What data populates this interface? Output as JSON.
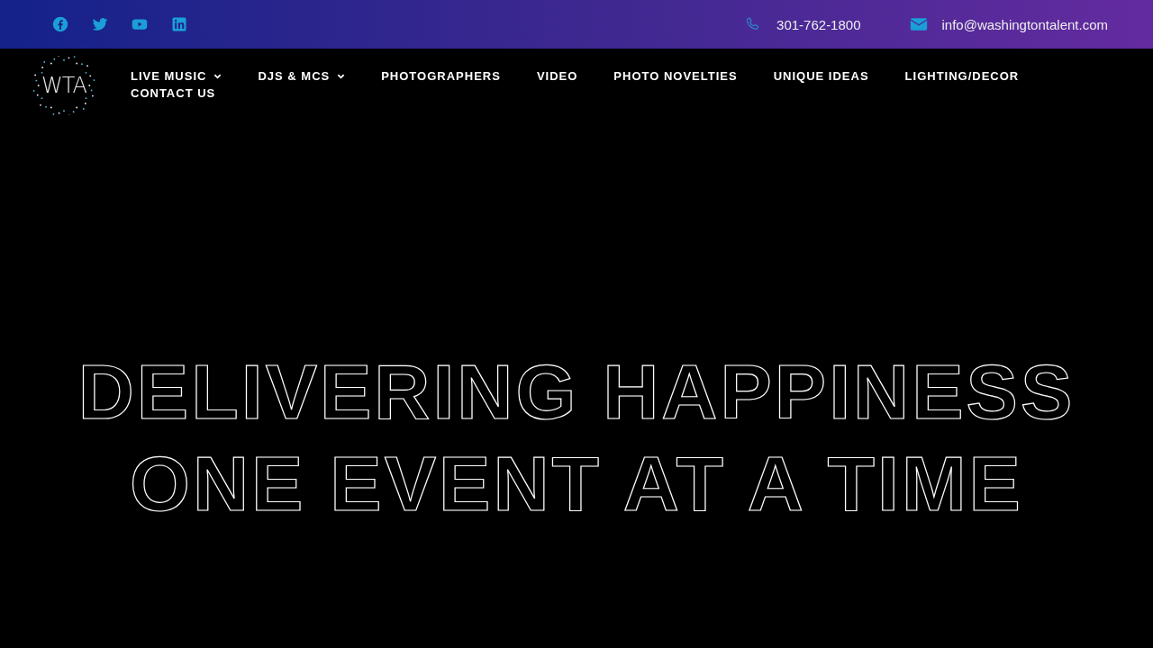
{
  "top_bar": {
    "social_links": [
      {
        "kind": "facebook"
      },
      {
        "kind": "twitter"
      },
      {
        "kind": "youtube"
      },
      {
        "kind": "linkedin"
      }
    ],
    "contacts": [
      {
        "kind": "phone",
        "text": "301-762-1800"
      },
      {
        "kind": "email",
        "text": "info@washingtontalent.com"
      }
    ]
  },
  "header": {
    "logo_text": "WTA",
    "nav": [
      {
        "label": "LIVE MUSIC",
        "has_menu": true
      },
      {
        "label": "DJS & MCS",
        "has_menu": true
      },
      {
        "label": "PHOTOGRAPHERS",
        "has_menu": false
      },
      {
        "label": "VIDEO",
        "has_menu": false
      },
      {
        "label": "PHOTO NOVELTIES",
        "has_menu": false
      },
      {
        "label": "UNIQUE IDEAS",
        "has_menu": false
      },
      {
        "label": "LIGHTING/DECOR",
        "has_menu": false
      },
      {
        "label": "CONTACT US",
        "has_menu": false
      }
    ]
  },
  "hero": {
    "lines": [
      "DELIVERING HAPPINESS",
      "ONE EVENT AT A TIME"
    ]
  }
}
